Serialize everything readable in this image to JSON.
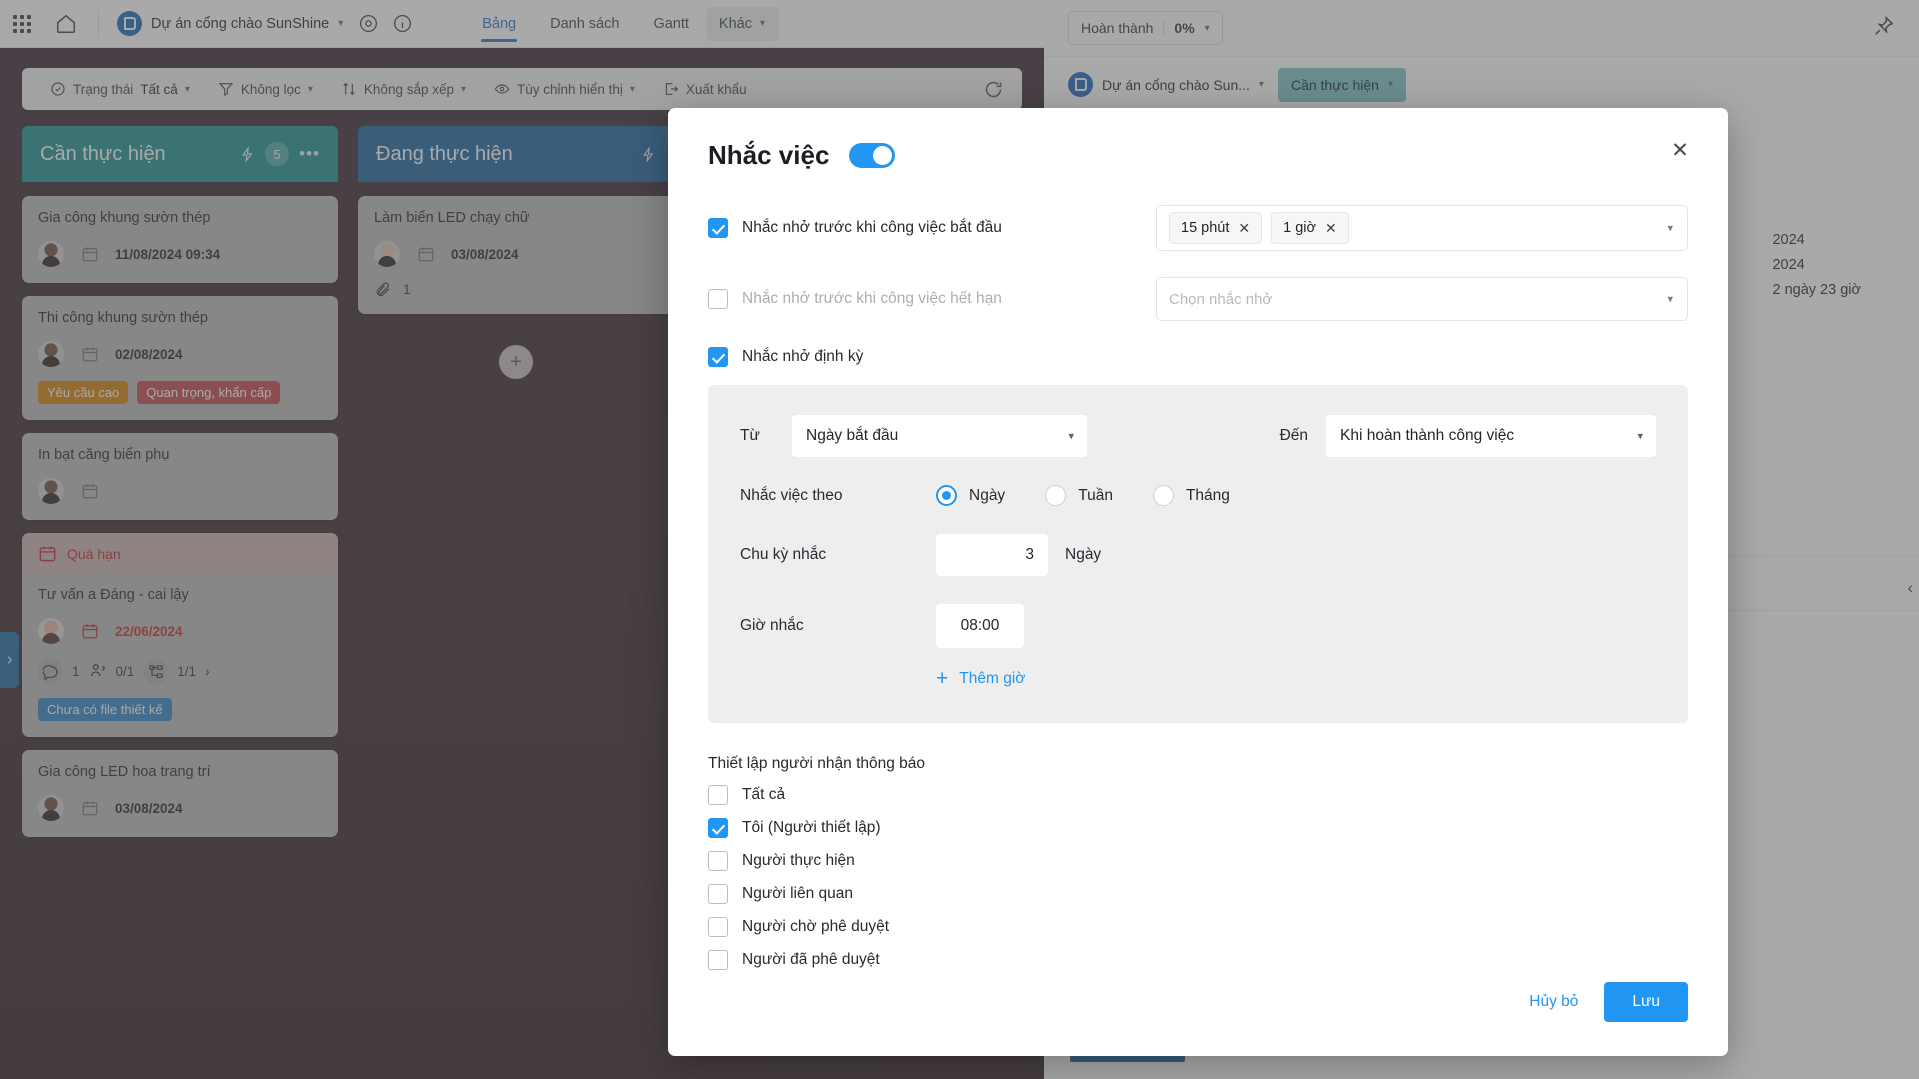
{
  "topbar": {
    "apps_icon": "grid-apps-icon",
    "home_icon": "home-icon",
    "project_name": "Dự án cổng chào SunShine",
    "settings_icon": "settings-icon",
    "info_icon": "info-icon",
    "tabs": [
      {
        "label": "Bảng",
        "active": true
      },
      {
        "label": "Danh sách",
        "active": false
      },
      {
        "label": "Gantt",
        "active": false
      },
      {
        "label": "Khác",
        "active": false,
        "boxed": true
      }
    ]
  },
  "toolbar": {
    "status_label": "Trạng thái",
    "status_value": "Tất cả",
    "filter": "Không lọc",
    "sort": "Không sắp xếp",
    "display": "Tùy chỉnh hiển thị",
    "export": "Xuất khẩu",
    "refresh_icon": "refresh-icon"
  },
  "board": {
    "columns": [
      {
        "title": "Cần thực hiện",
        "count": "5",
        "cards": [
          {
            "title": "Gia công khung sườn thép",
            "date": "11/08/2024 09:34"
          },
          {
            "title": "Thi công khung sườn thép",
            "date": "02/08/2024",
            "tags": [
              {
                "label": "Yêu cầu cao",
                "color": "orange"
              },
              {
                "label": "Quan trọng, khẩn cấp",
                "color": "red"
              }
            ]
          },
          {
            "title": "In bạt căng biển phụ",
            "date": ""
          },
          {
            "overdue_label": "Quá hạn",
            "title": "Tư vấn a Đáng - cai lậy",
            "date": "22/06/2024",
            "meta": {
              "comments": "1",
              "assignees": "0/1",
              "subtasks": "1/1"
            },
            "tags": [
              {
                "label": "Chưa có file thiết kế",
                "color": "blue"
              }
            ]
          },
          {
            "title": "Gia công LED hoa trang trí",
            "date": "03/08/2024"
          }
        ]
      },
      {
        "title": "Đang thực hiện",
        "count": "",
        "cards": [
          {
            "title": "Làm biển LED chạy chữ",
            "date": "03/08/2024",
            "attachments": "1"
          }
        ],
        "add_card": "+"
      }
    ],
    "side_handle_icon": "chevron-right-icon"
  },
  "right_panel": {
    "progress_label": "Hoàn thành",
    "progress_value": "0%",
    "pin_icon": "pin-icon",
    "project_name": "Dự án cổng chào Sun...",
    "status": "Cần thực hiện",
    "dates": [
      "2024",
      "2024",
      "2 ngày 23 giờ"
    ],
    "collapse_icon": "chevron-left-icon"
  },
  "modal": {
    "title": "Nhắc việc",
    "enabled_toggle": true,
    "close_icon": "close-icon",
    "reminders": [
      {
        "checked": true,
        "label": "Nhắc nhở trước khi công việc bắt đầu",
        "chips": [
          "15 phút",
          "1 giờ"
        ],
        "placeholder": ""
      },
      {
        "checked": false,
        "label": "Nhắc nhở trước khi công việc hết hạn",
        "chips": [],
        "placeholder": "Chọn nhắc nhở"
      }
    ],
    "recurring": {
      "checked": true,
      "label": "Nhắc nhở định kỳ",
      "from_label": "Từ",
      "from_value": "Ngày bắt đầu",
      "to_label": "Đến",
      "to_value": "Khi hoàn thành công việc",
      "repeat_by_label": "Nhắc việc theo",
      "repeat_options": [
        {
          "label": "Ngày",
          "selected": true
        },
        {
          "label": "Tuần",
          "selected": false
        },
        {
          "label": "Tháng",
          "selected": false
        }
      ],
      "cycle_label": "Chu kỳ nhắc",
      "cycle_value": "3",
      "cycle_unit": "Ngày",
      "time_label": "Giờ nhắc",
      "time_value": "08:00",
      "add_time_label": "Thêm giờ"
    },
    "recipients": {
      "title": "Thiết lập người nhận thông báo",
      "options": [
        {
          "label": "Tất cả",
          "checked": false
        },
        {
          "label": "Tôi (Người thiết lập)",
          "checked": true
        },
        {
          "label": "Người thực hiện",
          "checked": false
        },
        {
          "label": "Người liên quan",
          "checked": false
        },
        {
          "label": "Người chờ phê duyệt",
          "checked": false
        },
        {
          "label": "Người đã phê duyệt",
          "checked": false
        }
      ]
    },
    "cancel_label": "Hủy bỏ",
    "save_label": "Lưu"
  },
  "colors": {
    "accent": "#2196f3",
    "todo_column": "#1b8f93",
    "doing_column": "#17609e",
    "overdue": "#c62828"
  }
}
